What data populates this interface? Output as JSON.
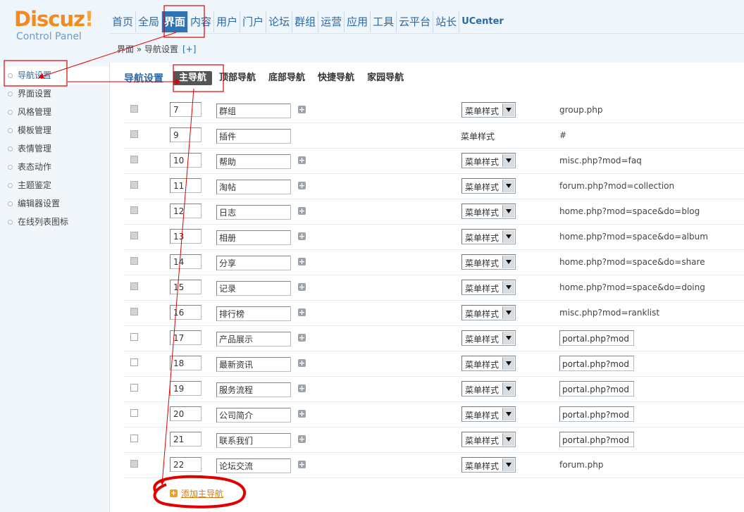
{
  "logo": {
    "brand": "Discuz",
    "mark": "!",
    "sub": "Control Panel"
  },
  "topnav": [
    {
      "label": "首页",
      "active": false
    },
    {
      "label": "全局",
      "active": false
    },
    {
      "label": "界面",
      "active": true
    },
    {
      "label": "内容",
      "active": false
    },
    {
      "label": "用户",
      "active": false
    },
    {
      "label": "门户",
      "active": false
    },
    {
      "label": "论坛",
      "active": false
    },
    {
      "label": "群组",
      "active": false
    },
    {
      "label": "运营",
      "active": false
    },
    {
      "label": "应用",
      "active": false
    },
    {
      "label": "工具",
      "active": false
    },
    {
      "label": "云平台",
      "active": false
    },
    {
      "label": "站长",
      "active": false
    },
    {
      "label": "UCenter",
      "active": false
    }
  ],
  "breadcrumb": {
    "text": "界面 » 导航设置",
    "plus": "[+]"
  },
  "sidebar": [
    {
      "label": "导航设置",
      "active": true
    },
    {
      "label": "界面设置",
      "active": false
    },
    {
      "label": "风格管理",
      "active": false
    },
    {
      "label": "模板管理",
      "active": false
    },
    {
      "label": "表情管理",
      "active": false
    },
    {
      "label": "表态动作",
      "active": false
    },
    {
      "label": "主题鉴定",
      "active": false
    },
    {
      "label": "编辑器设置",
      "active": false
    },
    {
      "label": "在线列表图标",
      "active": false
    }
  ],
  "subtabs": {
    "title": "导航设置",
    "tabs": [
      {
        "label": "主导航",
        "active": true
      },
      {
        "label": "顶部导航",
        "active": false
      },
      {
        "label": "底部导航",
        "active": false
      },
      {
        "label": "快捷导航",
        "active": false
      },
      {
        "label": "家园导航",
        "active": false
      }
    ]
  },
  "rows": [
    {
      "order": "7",
      "name": "群组",
      "has_sub": true,
      "style": "菜单样式",
      "style_select": true,
      "url": "group.php",
      "url_editable": false,
      "checkbox_disabled": true
    },
    {
      "order": "9",
      "name": "插件",
      "has_sub": false,
      "style": "菜单样式",
      "style_select": false,
      "url": "#",
      "url_editable": false,
      "checkbox_disabled": true
    },
    {
      "order": "10",
      "name": "帮助",
      "has_sub": true,
      "style": "菜单样式",
      "style_select": true,
      "url": "misc.php?mod=faq",
      "url_editable": false,
      "checkbox_disabled": true
    },
    {
      "order": "11",
      "name": "淘帖",
      "has_sub": true,
      "style": "菜单样式",
      "style_select": true,
      "url": "forum.php?mod=collection",
      "url_editable": false,
      "checkbox_disabled": true
    },
    {
      "order": "12",
      "name": "日志",
      "has_sub": true,
      "style": "菜单样式",
      "style_select": true,
      "url": "home.php?mod=space&do=blog",
      "url_editable": false,
      "checkbox_disabled": true
    },
    {
      "order": "13",
      "name": "相册",
      "has_sub": true,
      "style": "菜单样式",
      "style_select": true,
      "url": "home.php?mod=space&do=album",
      "url_editable": false,
      "checkbox_disabled": true
    },
    {
      "order": "14",
      "name": "分享",
      "has_sub": true,
      "style": "菜单样式",
      "style_select": true,
      "url": "home.php?mod=space&do=share",
      "url_editable": false,
      "checkbox_disabled": true
    },
    {
      "order": "15",
      "name": "记录",
      "has_sub": true,
      "style": "菜单样式",
      "style_select": true,
      "url": "home.php?mod=space&do=doing",
      "url_editable": false,
      "checkbox_disabled": true
    },
    {
      "order": "16",
      "name": "排行榜",
      "has_sub": true,
      "style": "菜单样式",
      "style_select": true,
      "url": "misc.php?mod=ranklist",
      "url_editable": false,
      "checkbox_disabled": true
    },
    {
      "order": "17",
      "name": "产品展示",
      "has_sub": true,
      "style": "菜单样式",
      "style_select": true,
      "url": "portal.php?mod",
      "url_editable": true,
      "checkbox_disabled": false
    },
    {
      "order": "18",
      "name": "最新资讯",
      "has_sub": true,
      "style": "菜单样式",
      "style_select": true,
      "url": "portal.php?mod",
      "url_editable": true,
      "checkbox_disabled": false
    },
    {
      "order": "19",
      "name": "服务流程",
      "has_sub": true,
      "style": "菜单样式",
      "style_select": true,
      "url": "portal.php?mod",
      "url_editable": true,
      "checkbox_disabled": false
    },
    {
      "order": "20",
      "name": "公司简介",
      "has_sub": true,
      "style": "菜单样式",
      "style_select": true,
      "url": "portal.php?mod",
      "url_editable": true,
      "checkbox_disabled": false
    },
    {
      "order": "21",
      "name": "联系我们",
      "has_sub": true,
      "style": "菜单样式",
      "style_select": true,
      "url": "portal.php?mod",
      "url_editable": true,
      "checkbox_disabled": false
    },
    {
      "order": "22",
      "name": "论坛交流",
      "has_sub": true,
      "style": "菜单样式",
      "style_select": true,
      "url": "forum.php",
      "url_editable": false,
      "checkbox_disabled": true
    }
  ],
  "add_main_nav": {
    "icon": "add-icon",
    "label": "添加主导航"
  },
  "colors": {
    "accent": "#2f73b4",
    "annotation": "#e00000",
    "add_link": "#d57c10"
  }
}
